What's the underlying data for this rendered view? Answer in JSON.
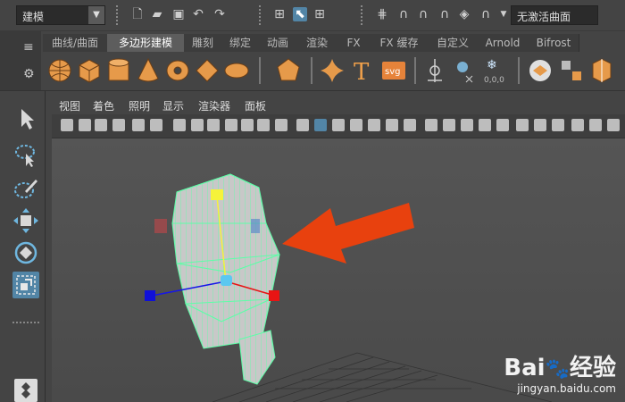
{
  "status_line": {
    "menu_set": "建模",
    "live_surface": "无激活曲面"
  },
  "shelf": {
    "tabs": [
      "曲线/曲面",
      "多边形建模",
      "雕刻",
      "绑定",
      "动画",
      "渲染",
      "FX",
      "FX 缓存",
      "自定义",
      "Arnold",
      "Bifrost"
    ],
    "active_tab": "多边形建模",
    "text_tool_label": "T",
    "svg_tool_label": "svg"
  },
  "panel": {
    "menus": [
      "视图",
      "着色",
      "照明",
      "显示",
      "渲染器",
      "面板"
    ]
  },
  "watermark": {
    "brand": "Bai",
    "brand2": "经验",
    "url": "jingyan.baidu.com"
  },
  "colors": {
    "accent": "#5285a6",
    "arrow": "#e8410e",
    "wire": "#5dffa8",
    "viewport_bg": "#5a5a5a"
  }
}
